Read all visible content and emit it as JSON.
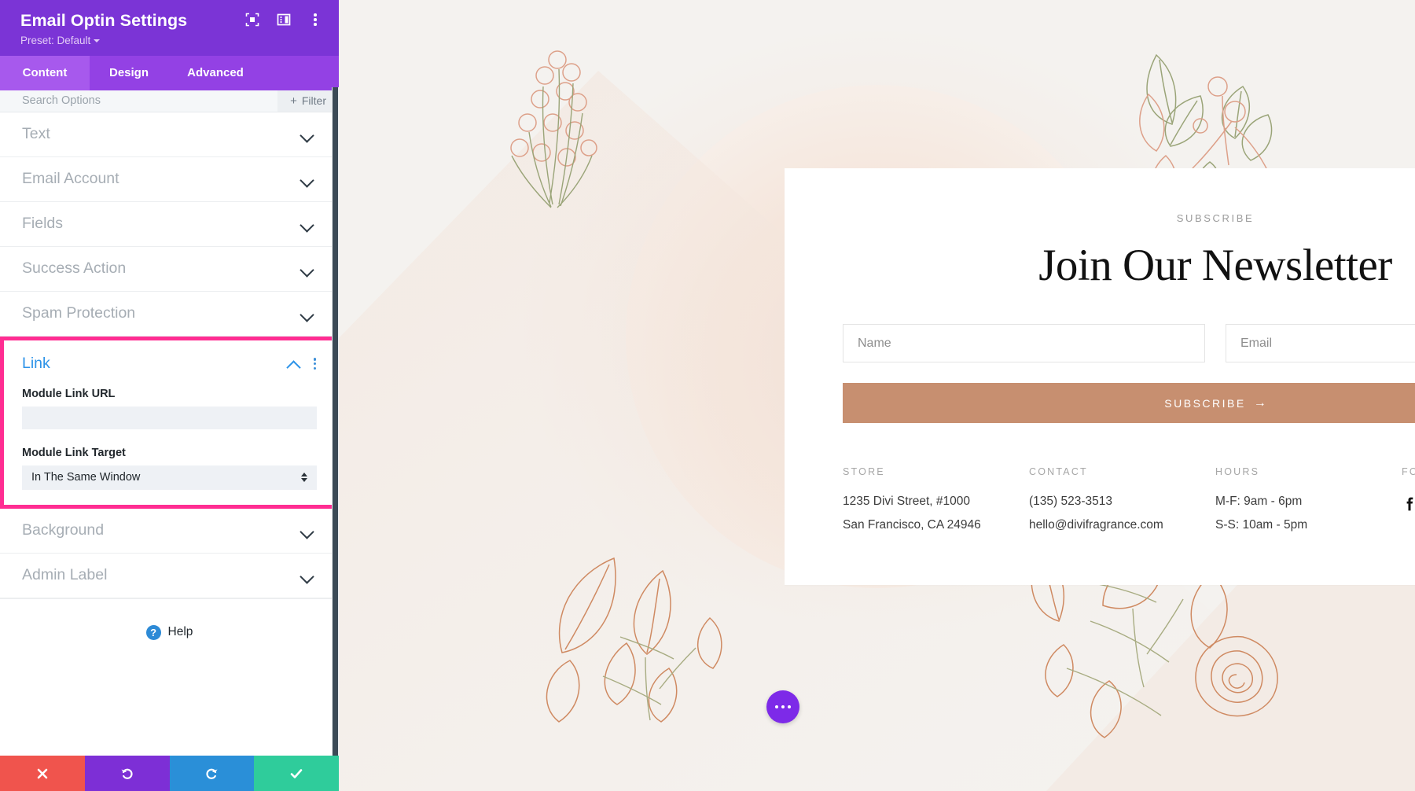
{
  "panel": {
    "title": "Email Optin Settings",
    "preset": "Preset: Default",
    "header_icons": [
      {
        "name": "focus-frame-icon",
        "label": "Focus"
      },
      {
        "name": "panel-layout-icon",
        "label": "Layout"
      },
      {
        "name": "more-options-icon",
        "label": "More"
      }
    ],
    "tabs": [
      {
        "label": "Content",
        "active": true
      },
      {
        "label": "Design",
        "active": false
      },
      {
        "label": "Advanced",
        "active": false
      }
    ],
    "search": {
      "placeholder": "Search Options",
      "filter_label": "Filter",
      "filter_plus": "+"
    },
    "sections_before": [
      {
        "label": "Text"
      },
      {
        "label": "Email Account"
      },
      {
        "label": "Fields"
      },
      {
        "label": "Success Action"
      },
      {
        "label": "Spam Protection"
      }
    ],
    "link_section": {
      "label": "Link",
      "highlighted": true,
      "highlight_color": "#ff2d92",
      "accent_color": "#2d93e8",
      "fields": [
        {
          "label": "Module Link URL",
          "type": "text",
          "value": "",
          "placeholder": ""
        },
        {
          "label": "Module Link Target",
          "type": "select",
          "value": "In The Same Window"
        }
      ]
    },
    "sections_after": [
      {
        "label": "Background"
      },
      {
        "label": "Admin Label"
      }
    ],
    "help": {
      "label": "Help",
      "badge": "?"
    },
    "action_bar": [
      {
        "name": "cancel-button",
        "glyph": "✖",
        "color": "#f0544d"
      },
      {
        "name": "undo-button",
        "glyph": "↺",
        "color": "#7d2fd6"
      },
      {
        "name": "redo-button",
        "glyph": "↻",
        "color": "#2a8fd8"
      },
      {
        "name": "save-button",
        "glyph": "✔",
        "color": "#2fcc9b"
      }
    ]
  },
  "canvas": {
    "optin": {
      "eyebrow": "SUBSCRIBE",
      "headline": "Join Our Newsletter",
      "fields": [
        {
          "name": "name-input",
          "placeholder": "Name",
          "value": ""
        },
        {
          "name": "email-input",
          "placeholder": "Email",
          "value": ""
        }
      ],
      "submit": {
        "label": "SUBSCRIBE",
        "arrow": "→",
        "color": "#c78f70"
      },
      "columns": [
        {
          "title": "STORE",
          "lines": [
            "1235 Divi Street, #1000",
            "San Francisco, CA 24946"
          ]
        },
        {
          "title": "CONTACT",
          "lines": [
            "(135) 523-3513",
            "hello@divifragrance.com"
          ]
        },
        {
          "title": "HOURS",
          "lines": [
            "M-F: 9am - 6pm",
            "S-S: 10am - 5pm"
          ]
        },
        {
          "title": "FOLLOW",
          "lines": [],
          "socials": [
            "facebook-icon",
            "twitter-icon",
            "instagram-icon"
          ]
        }
      ]
    },
    "fab": {
      "name": "module-settings-fab",
      "glyph": "…"
    }
  }
}
